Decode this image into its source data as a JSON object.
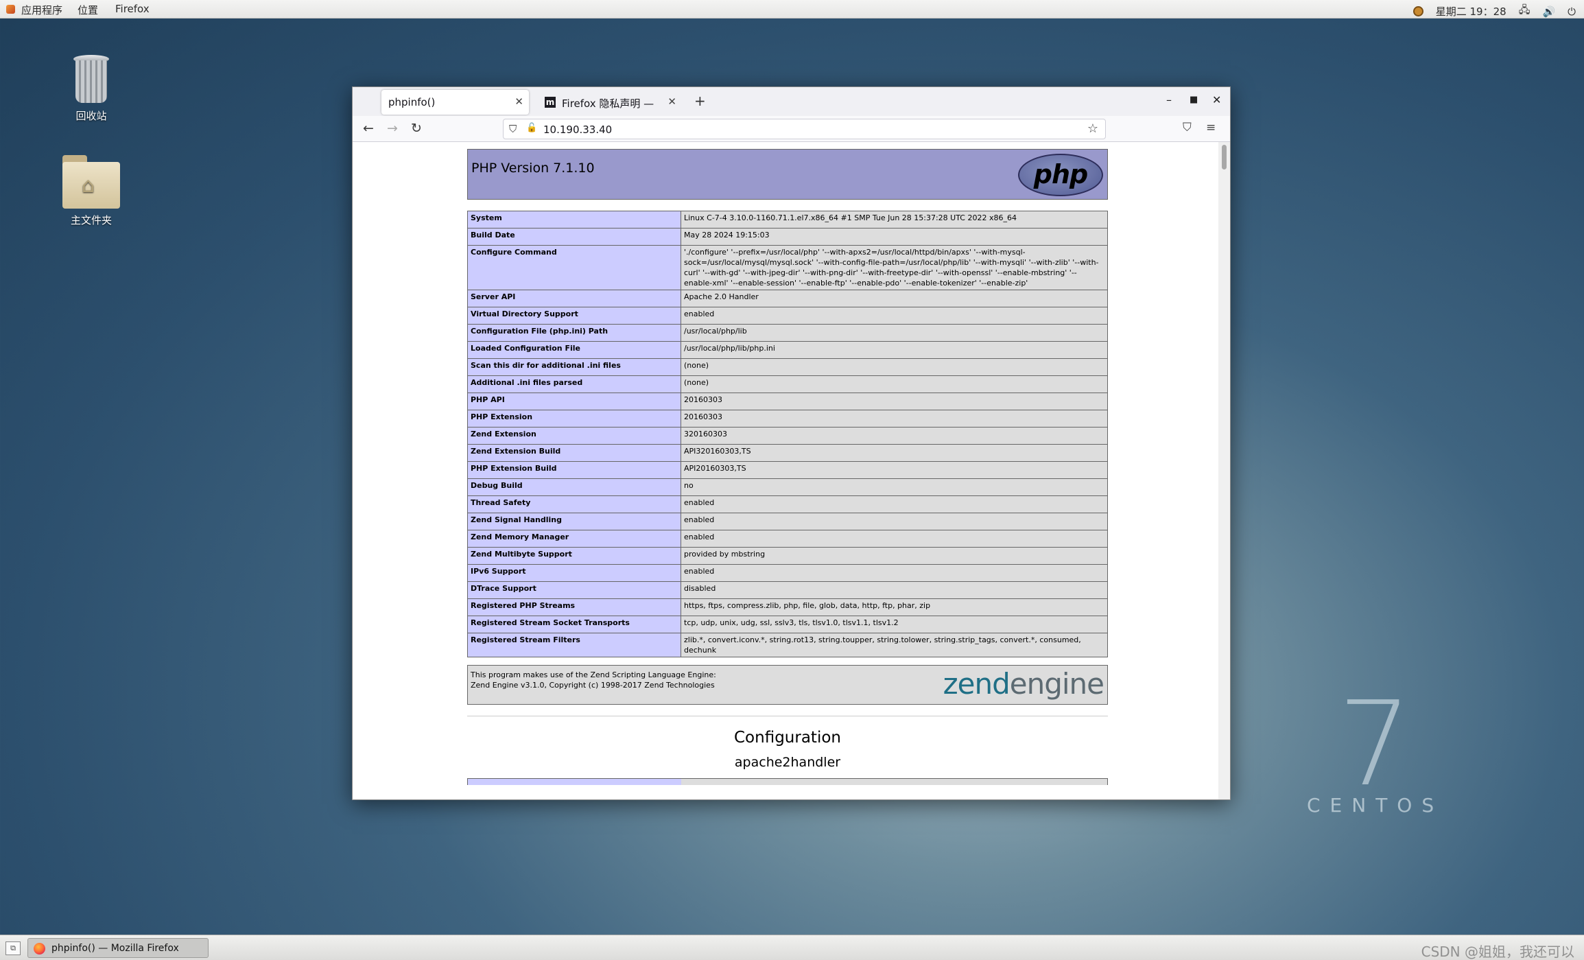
{
  "top_panel": {
    "menu_items": [
      "应用程序",
      "位置",
      "Firefox"
    ],
    "clock": "星期二 19：28"
  },
  "desktop": {
    "icons": [
      {
        "label": "回收站",
        "icon": "trash-icon"
      },
      {
        "label": "主文件夹",
        "icon": "home-folder-icon"
      }
    ],
    "brand": {
      "number": "7",
      "word": "CENTOS"
    }
  },
  "browser": {
    "tabs": [
      {
        "title": "phpinfo()",
        "active": true
      },
      {
        "title": "Firefox 隐私声明 — Mozilla",
        "active": false,
        "favicon": "m"
      }
    ],
    "url": "10.190.33.40"
  },
  "phpinfo": {
    "version_title": "PHP Version 7.1.10",
    "logo_text": "php",
    "rows": [
      {
        "key": "System",
        "value": "Linux C-7-4 3.10.0-1160.71.1.el7.x86_64 #1 SMP Tue Jun 28 15:37:28 UTC 2022 x86_64"
      },
      {
        "key": "Build Date",
        "value": "May 28 2024 19:15:03"
      },
      {
        "key": "Configure Command",
        "value": "'./configure' '--prefix=/usr/local/php' '--with-apxs2=/usr/local/httpd/bin/apxs' '--with-mysql-sock=/usr/local/mysql/mysql.sock' '--with-config-file-path=/usr/local/php/lib' '--with-mysqli' '--with-zlib' '--with-curl' '--with-gd' '--with-jpeg-dir' '--with-png-dir' '--with-freetype-dir' '--with-openssl' '--enable-mbstring' '--enable-xml' '--enable-session' '--enable-ftp' '--enable-pdo' '--enable-tokenizer' '--enable-zip'"
      },
      {
        "key": "Server API",
        "value": "Apache 2.0 Handler"
      },
      {
        "key": "Virtual Directory Support",
        "value": "enabled"
      },
      {
        "key": "Configuration File (php.ini) Path",
        "value": "/usr/local/php/lib"
      },
      {
        "key": "Loaded Configuration File",
        "value": "/usr/local/php/lib/php.ini"
      },
      {
        "key": "Scan this dir for additional .ini files",
        "value": "(none)"
      },
      {
        "key": "Additional .ini files parsed",
        "value": "(none)"
      },
      {
        "key": "PHP API",
        "value": "20160303"
      },
      {
        "key": "PHP Extension",
        "value": "20160303"
      },
      {
        "key": "Zend Extension",
        "value": "320160303"
      },
      {
        "key": "Zend Extension Build",
        "value": "API320160303,TS"
      },
      {
        "key": "PHP Extension Build",
        "value": "API20160303,TS"
      },
      {
        "key": "Debug Build",
        "value": "no"
      },
      {
        "key": "Thread Safety",
        "value": "enabled"
      },
      {
        "key": "Zend Signal Handling",
        "value": "enabled"
      },
      {
        "key": "Zend Memory Manager",
        "value": "enabled"
      },
      {
        "key": "Zend Multibyte Support",
        "value": "provided by mbstring"
      },
      {
        "key": "IPv6 Support",
        "value": "enabled"
      },
      {
        "key": "DTrace Support",
        "value": "disabled"
      },
      {
        "key": "Registered PHP Streams",
        "value": "https, ftps, compress.zlib, php, file, glob, data, http, ftp, phar, zip"
      },
      {
        "key": "Registered Stream Socket Transports",
        "value": "tcp, udp, unix, udg, ssl, sslv3, tls, tlsv1.0, tlsv1.1, tlsv1.2"
      },
      {
        "key": "Registered Stream Filters",
        "value": "zlib.*, convert.iconv.*, string.rot13, string.toupper, string.tolower, string.strip_tags, convert.*, consumed, dechunk"
      }
    ],
    "zend": {
      "line1": "This program makes use of the Zend Scripting Language Engine:",
      "line2": "Zend Engine v3.1.0, Copyright (c) 1998-2017 Zend Technologies",
      "logo_part1": "zend",
      "logo_part2": "engine"
    },
    "section_title": "Configuration",
    "subsection_title": "apache2handler"
  },
  "taskbar": {
    "item_label": "phpinfo() — Mozilla Firefox",
    "watermark": "CSDN @姐姐，我还可以"
  }
}
